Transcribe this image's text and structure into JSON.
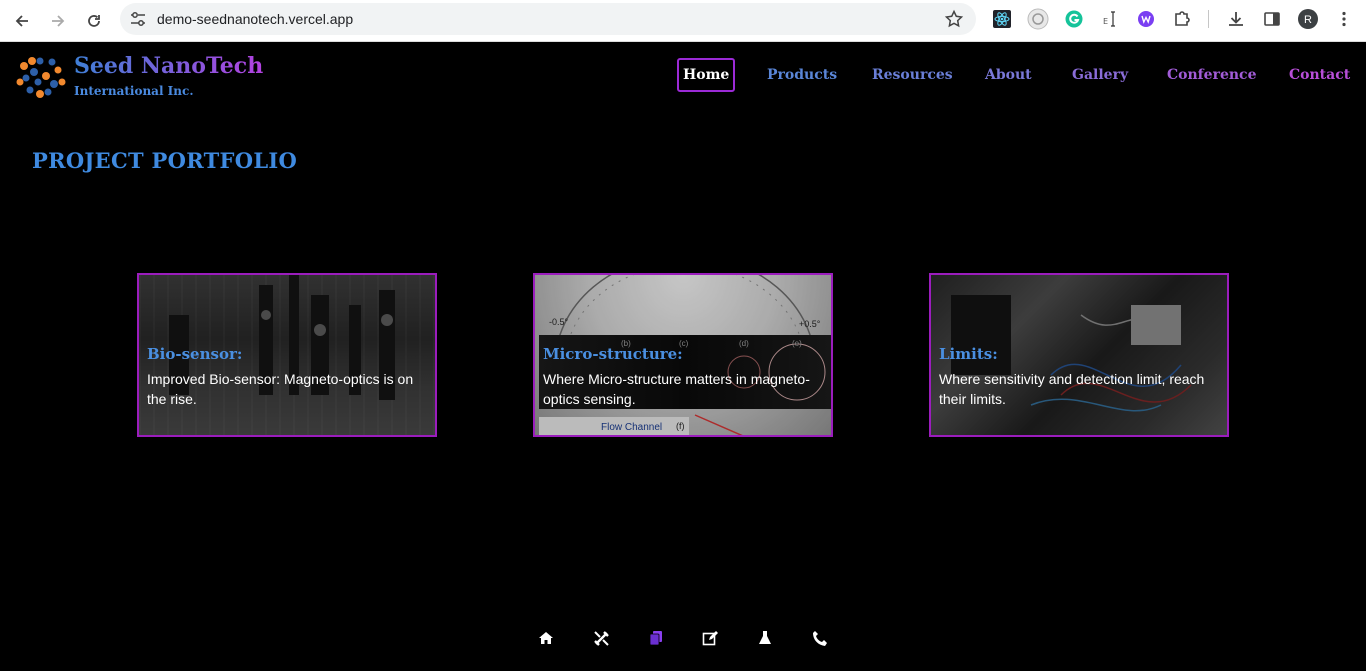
{
  "browser": {
    "url": "demo-seednanotech.vercel.app",
    "profile_initial": "R",
    "extensions": [
      "react-devtools-icon",
      "speed-dial-icon",
      "grammarly-icon",
      "text-cursor-icon",
      "wappalyzer-icon",
      "puzzle-icon"
    ]
  },
  "site": {
    "brand": {
      "name": "Seed NanoTech",
      "subtitle": "International Inc."
    },
    "nav": [
      {
        "label": "Home",
        "active": true
      },
      {
        "label": "Products"
      },
      {
        "label": "Resources"
      },
      {
        "label": "About"
      },
      {
        "label": "Gallery"
      },
      {
        "label": "Conference"
      },
      {
        "label": "Contact"
      }
    ],
    "section_title": "PROJECT PORTFOLIO",
    "cards": [
      {
        "title": "Bio-sensor:",
        "description": "Improved Bio-sensor: Magneto-optics is on the rise."
      },
      {
        "title": "Micro-structure:",
        "description": "Where Micro-structure matters in magneto-optics sensing."
      },
      {
        "title": "Limits:",
        "description": "Where sensitivity and detection limit, reach their limits."
      }
    ],
    "card2_image_text": {
      "left": "-0.5°",
      "right": "+0.5°",
      "flow": "Flow Channel",
      "labels": [
        "(b)",
        "(c)",
        "(d)",
        "(e)",
        "(f)"
      ]
    },
    "dock": [
      "home-icon",
      "tools-icon",
      "copy-icon",
      "edit-icon",
      "flask-icon",
      "phone-icon"
    ]
  },
  "colors": {
    "accent_blue": "#3f8ae0",
    "accent_purple": "#9b2ad6",
    "card_border": "#9b1dbd",
    "orange": "#f2892e"
  }
}
